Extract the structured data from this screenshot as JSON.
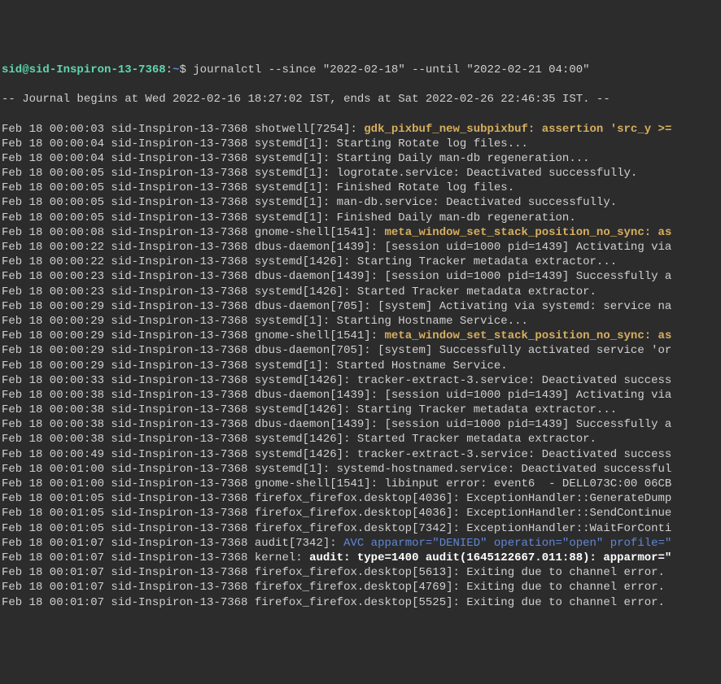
{
  "prompt": {
    "user": "sid",
    "at": "@",
    "host": "sid-Inspiron-13-7368",
    "colon": ":",
    "path": "~",
    "dollar": "$ ",
    "command": "journalctl --since \"2022-02-18\" --until \"2022-02-21 04:00\""
  },
  "header": "-- Journal begins at Wed 2022-02-16 18:27:02 IST, ends at Sat 2022-02-26 22:46:35 IST. --",
  "lines": [
    {
      "pre": "Feb 18 00:00:03 sid-Inspiron-13-7368 shotwell[7254]: ",
      "warn": "gdk_pixbuf_new_subpixbuf: assertion 'src_y >="
    },
    {
      "pre": "Feb 18 00:00:04 sid-Inspiron-13-7368 systemd[1]: Starting Rotate log files..."
    },
    {
      "pre": "Feb 18 00:00:04 sid-Inspiron-13-7368 systemd[1]: Starting Daily man-db regeneration..."
    },
    {
      "pre": "Feb 18 00:00:05 sid-Inspiron-13-7368 systemd[1]: logrotate.service: Deactivated successfully."
    },
    {
      "pre": "Feb 18 00:00:05 sid-Inspiron-13-7368 systemd[1]: Finished Rotate log files."
    },
    {
      "pre": "Feb 18 00:00:05 sid-Inspiron-13-7368 systemd[1]: man-db.service: Deactivated successfully."
    },
    {
      "pre": "Feb 18 00:00:05 sid-Inspiron-13-7368 systemd[1]: Finished Daily man-db regeneration."
    },
    {
      "pre": "Feb 18 00:00:08 sid-Inspiron-13-7368 gnome-shell[1541]: ",
      "warn": "meta_window_set_stack_position_no_sync: as"
    },
    {
      "pre": "Feb 18 00:00:22 sid-Inspiron-13-7368 dbus-daemon[1439]: [session uid=1000 pid=1439] Activating via"
    },
    {
      "pre": "Feb 18 00:00:22 sid-Inspiron-13-7368 systemd[1426]: Starting Tracker metadata extractor..."
    },
    {
      "pre": "Feb 18 00:00:23 sid-Inspiron-13-7368 dbus-daemon[1439]: [session uid=1000 pid=1439] Successfully a"
    },
    {
      "pre": "Feb 18 00:00:23 sid-Inspiron-13-7368 systemd[1426]: Started Tracker metadata extractor."
    },
    {
      "pre": "Feb 18 00:00:29 sid-Inspiron-13-7368 dbus-daemon[705]: [system] Activating via systemd: service na"
    },
    {
      "pre": "Feb 18 00:00:29 sid-Inspiron-13-7368 systemd[1]: Starting Hostname Service..."
    },
    {
      "pre": "Feb 18 00:00:29 sid-Inspiron-13-7368 gnome-shell[1541]: ",
      "warn": "meta_window_set_stack_position_no_sync: as"
    },
    {
      "pre": "Feb 18 00:00:29 sid-Inspiron-13-7368 dbus-daemon[705]: [system] Successfully activated service 'or"
    },
    {
      "pre": "Feb 18 00:00:29 sid-Inspiron-13-7368 systemd[1]: Started Hostname Service."
    },
    {
      "pre": "Feb 18 00:00:33 sid-Inspiron-13-7368 systemd[1426]: tracker-extract-3.service: Deactivated success"
    },
    {
      "pre": "Feb 18 00:00:38 sid-Inspiron-13-7368 dbus-daemon[1439]: [session uid=1000 pid=1439] Activating via"
    },
    {
      "pre": "Feb 18 00:00:38 sid-Inspiron-13-7368 systemd[1426]: Starting Tracker metadata extractor..."
    },
    {
      "pre": "Feb 18 00:00:38 sid-Inspiron-13-7368 dbus-daemon[1439]: [session uid=1000 pid=1439] Successfully a"
    },
    {
      "pre": "Feb 18 00:00:38 sid-Inspiron-13-7368 systemd[1426]: Started Tracker metadata extractor."
    },
    {
      "pre": "Feb 18 00:00:49 sid-Inspiron-13-7368 systemd[1426]: tracker-extract-3.service: Deactivated success"
    },
    {
      "pre": "Feb 18 00:01:00 sid-Inspiron-13-7368 systemd[1]: systemd-hostnamed.service: Deactivated successful"
    },
    {
      "pre": "Feb 18 00:01:00 sid-Inspiron-13-7368 gnome-shell[1541]: libinput error: event6  - DELL073C:00 06CB"
    },
    {
      "pre": "Feb 18 00:01:05 sid-Inspiron-13-7368 firefox_firefox.desktop[4036]: ExceptionHandler::GenerateDump"
    },
    {
      "pre": "Feb 18 00:01:05 sid-Inspiron-13-7368 firefox_firefox.desktop[4036]: ExceptionHandler::SendContinue"
    },
    {
      "pre": "Feb 18 00:01:05 sid-Inspiron-13-7368 firefox_firefox.desktop[7342]: ExceptionHandler::WaitForConti"
    },
    {
      "pre": "Feb 18 00:01:07 sid-Inspiron-13-7368 audit[7342]: ",
      "audit": "AVC apparmor=\"DENIED\" operation=\"open\" profile=\""
    },
    {
      "pre": "Feb 18 00:01:07 sid-Inspiron-13-7368 kernel: ",
      "bold": "audit: type=1400 audit(1645122667.011:88): apparmor=\""
    },
    {
      "pre": "Feb 18 00:01:07 sid-Inspiron-13-7368 firefox_firefox.desktop[5613]: Exiting due to channel error."
    },
    {
      "pre": "Feb 18 00:01:07 sid-Inspiron-13-7368 firefox_firefox.desktop[4769]: Exiting due to channel error."
    },
    {
      "pre": "Feb 18 00:01:07 sid-Inspiron-13-7368 firefox_firefox.desktop[5525]: Exiting due to channel error."
    }
  ]
}
